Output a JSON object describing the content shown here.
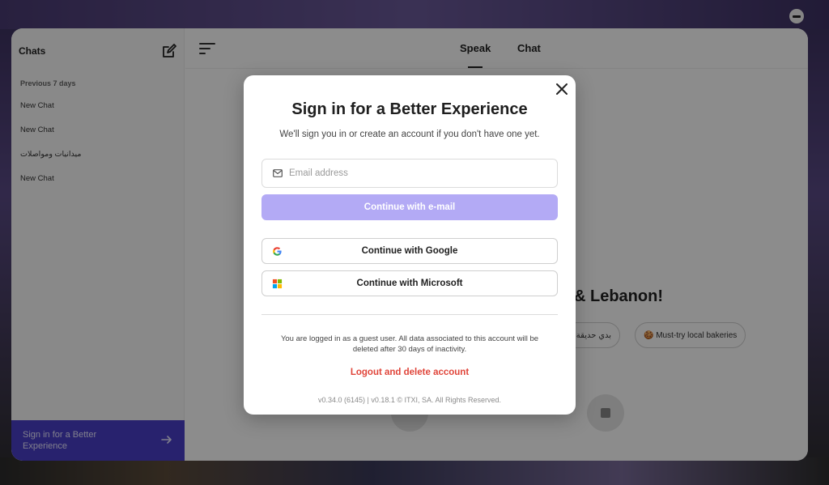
{
  "sidebar": {
    "title": "Chats",
    "section_label": "Previous 7 days",
    "items": [
      {
        "label": "New Chat"
      },
      {
        "label": "New Chat"
      },
      {
        "label": "ميدانيات ومواصلات"
      },
      {
        "label": "New Chat"
      }
    ],
    "signin_label": "Sign in for a Better Experience"
  },
  "topbar": {
    "tabs": [
      {
        "label": "Speak",
        "active": true
      },
      {
        "label": "Chat",
        "active": false
      }
    ]
  },
  "main": {
    "heading_partial": "& Lebanon!",
    "chips": [
      {
        "label": "بدي حديقة عا"
      },
      {
        "label": "🍪 Must-try local bakeries"
      }
    ]
  },
  "modal": {
    "title": "Sign in for a Better Experience",
    "subtitle": "We'll sign you in or create an account if you don't have one yet.",
    "email_placeholder": "Email address",
    "email_value": "",
    "continue_email_label": "Continue with e-mail",
    "google_label": "Continue with Google",
    "microsoft_label": "Continue with Microsoft",
    "guest_note": "You are logged in as a guest user. All data associated to this account will be deleted after 30 days of inactivity.",
    "logout_label": "Logout and delete account",
    "version_text": "v0.34.0 (6145) | v0.18.1 © ITXI, SA. All Rights Reserved."
  },
  "colors": {
    "accent": "#4a3fc9",
    "email_button": "#b3aaf5",
    "logout": "#e0453a"
  },
  "icons": [
    "minus-circle-icon",
    "compose-icon",
    "arrow-right-icon",
    "sort-icon",
    "close-icon",
    "mail-icon",
    "google-icon",
    "microsoft-icon",
    "stop-icon",
    "cookie-icon"
  ]
}
